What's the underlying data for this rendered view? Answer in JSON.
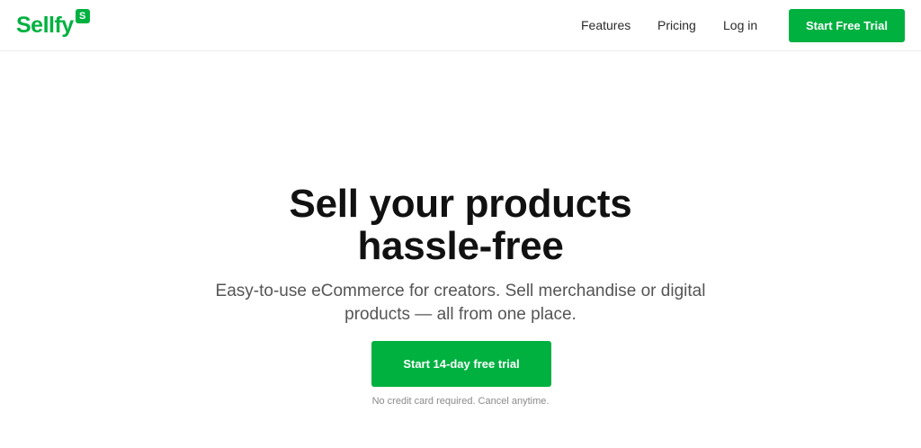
{
  "header": {
    "logo_text": "Sellfy",
    "logo_badge": "S",
    "nav": {
      "features": "Features",
      "pricing": "Pricing",
      "login": "Log in"
    },
    "cta_label": "Start Free Trial"
  },
  "hero": {
    "title_line1": "Sell your products",
    "title_line2": "hassle-free",
    "subtitle_line1": "Easy-to-use eCommerce for creators. Sell merchandise or digital",
    "subtitle_line2": "products — all from one place.",
    "cta_label": "Start 14-day free trial",
    "note": "No credit card required. Cancel anytime."
  },
  "colors": {
    "brand_green": "#00b140",
    "text_dark": "#111111",
    "text_muted": "#555555",
    "note_gray": "#8a8a8a"
  }
}
